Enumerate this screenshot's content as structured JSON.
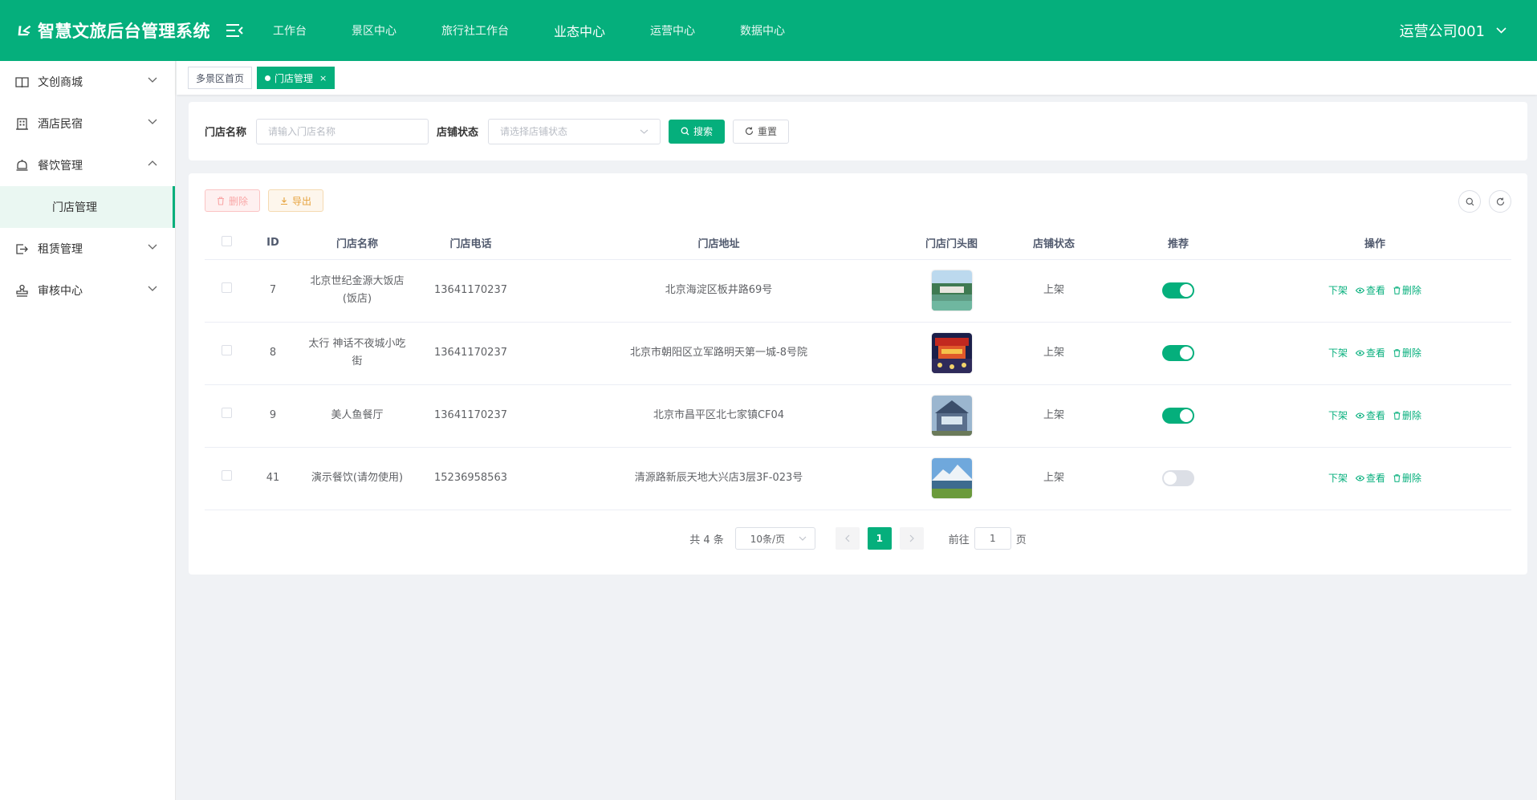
{
  "app": {
    "title": "智慧文旅后台管理系统"
  },
  "colors": {
    "primary": "#05af7c",
    "switch_off": "#dcdfe6",
    "danger": "#f56c6c",
    "warning": "#e6a23c"
  },
  "topnav": {
    "items": [
      {
        "label": "工作台"
      },
      {
        "label": "景区中心"
      },
      {
        "label": "旅行社工作台"
      },
      {
        "label": "业态中心",
        "active": true
      },
      {
        "label": "运营中心"
      },
      {
        "label": "数据中心"
      }
    ]
  },
  "user": {
    "name": "运营公司001"
  },
  "sidebar": {
    "items": [
      {
        "label": "文创商城",
        "icon": "book-icon"
      },
      {
        "label": "酒店民宿",
        "icon": "building-icon"
      },
      {
        "label": "餐饮管理",
        "icon": "bell-icon",
        "expanded": true
      },
      {
        "label": "门店管理",
        "sub": true,
        "active": true
      },
      {
        "label": "租赁管理",
        "icon": "exit-icon"
      },
      {
        "label": "审核中心",
        "icon": "stamp-icon"
      }
    ]
  },
  "tabs": {
    "home": "多景区首页",
    "current": "门店管理",
    "close": "×"
  },
  "search": {
    "name_label": "门店名称",
    "name_placeholder": "请输入门店名称",
    "status_label": "店铺状态",
    "status_placeholder": "请选择店铺状态",
    "search_button": "搜索",
    "reset_button": "重置"
  },
  "toolbar": {
    "delete_button": "删除",
    "export_button": "导出"
  },
  "table": {
    "columns": [
      "ID",
      "门店名称",
      "门店电话",
      "门店地址",
      "门店门头图",
      "店铺状态",
      "推荐",
      "操作"
    ],
    "rows": [
      {
        "id": "7",
        "name": "北京世纪金源大饭店(饭店)",
        "phone": "13641170237",
        "address": "北京海淀区板井路69号",
        "image": "scenic-lake-image",
        "status": "上架",
        "recommend": true
      },
      {
        "id": "8",
        "name": "太行 神话不夜城小吃街",
        "phone": "13641170237",
        "address": "北京市朝阳区立军路明天第一城-8号院",
        "image": "night-market-image",
        "status": "上架",
        "recommend": true
      },
      {
        "id": "9",
        "name": "美人鱼餐厅",
        "phone": "13641170237",
        "address": "北京市昌平区北七家镇CF04",
        "image": "restaurant-facade-image",
        "status": "上架",
        "recommend": true
      },
      {
        "id": "41",
        "name": "演示餐饮(请勿使用)",
        "phone": "15236958563",
        "address": "清源路新辰天地大兴店3层3F-023号",
        "image": "mountain-lake-image",
        "status": "上架",
        "recommend": false
      }
    ],
    "actions": {
      "offline": "下架",
      "view": "查看",
      "delete": "删除"
    }
  },
  "pagination": {
    "total": "共 4 条",
    "page_size": "10条/页",
    "current_page": "1",
    "goto_label": "前往",
    "goto_value": "1",
    "page_unit": "页"
  }
}
